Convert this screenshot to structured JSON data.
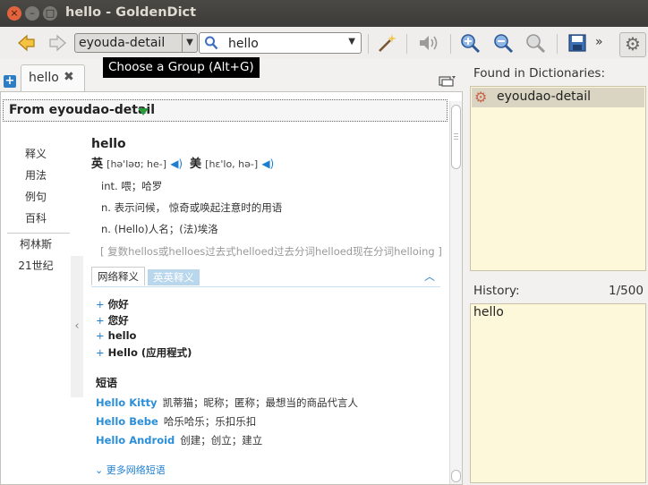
{
  "window": {
    "title": "hello - GoldenDict",
    "close_glyph": "×",
    "min_glyph": "–",
    "max_glyph": "□"
  },
  "toolbar": {
    "group_selected": "eyouda-detail",
    "search_value": "hello",
    "tooltip": "Choose a Group (Alt+G)",
    "more_glyph": "»"
  },
  "tabs": [
    {
      "label": "hello"
    }
  ],
  "article": {
    "dictionary_header": "From eyoudao-detail",
    "nav": [
      "释义",
      "用法",
      "例句",
      "百科",
      "柯林斯",
      "21世纪"
    ],
    "word": "hello",
    "pron": [
      {
        "lang": "英",
        "phonetic": "[hə'ləʊ; he-]"
      },
      {
        "lang": "美",
        "phonetic": "[hɛ'lo, hə-]"
      }
    ],
    "definitions": [
      "int. 喂；哈罗",
      "n. 表示问候， 惊奇或唤起注意时的用语",
      "n. (Hello)人名；(法)埃洛"
    ],
    "forms": "[ 复数hellos或helloes过去式helloed过去分词helloed现在分词helloing ]",
    "section_tabs": [
      "网络释义",
      "英英释义"
    ],
    "web_translations": [
      "你好",
      "您好",
      "hello",
      "Hello (应用程式)"
    ],
    "phrases_title": "短语",
    "phrases": [
      {
        "phrase": "Hello Kitty",
        "meaning": "凯蒂猫；昵称；匿称；最想当的商品代言人"
      },
      {
        "phrase": "Hello Bebe",
        "meaning": "哈乐哈乐；乐扣乐扣"
      },
      {
        "phrase": "Hello Android",
        "meaning": "创建；创立；建立"
      }
    ],
    "more_phrases": "更多网络短语"
  },
  "sidebar": {
    "found_label": "Found in Dictionaries:",
    "found_items": [
      "eyoudao-detail"
    ],
    "history_label": "History:",
    "history_count": "1/500",
    "history_items": [
      "hello"
    ]
  },
  "colors": {
    "accent": "#1e7fd0",
    "panel_bg": "#fdf8d9",
    "close_btn": "#e3643c"
  }
}
